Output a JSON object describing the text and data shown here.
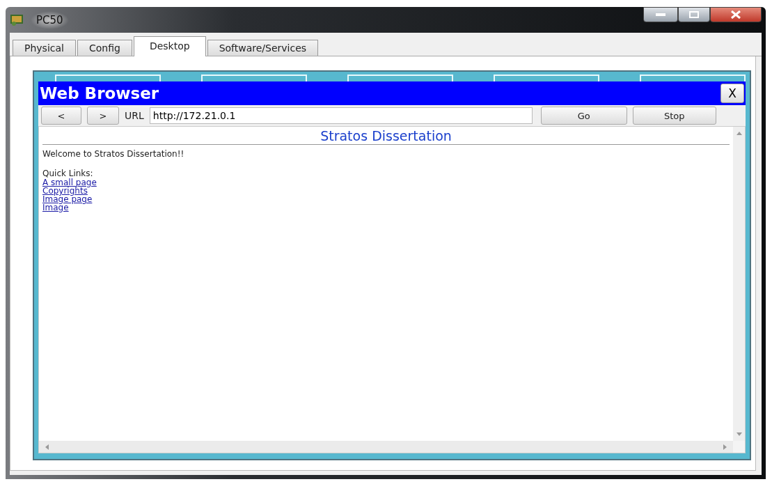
{
  "window": {
    "title": "PC50"
  },
  "tabs": [
    {
      "label": "Physical",
      "selected": false
    },
    {
      "label": "Config",
      "selected": false
    },
    {
      "label": "Desktop",
      "selected": true
    },
    {
      "label": "Software/Services",
      "selected": false
    }
  ],
  "browser": {
    "title": "Web Browser",
    "close": "X",
    "back": "<",
    "forward": ">",
    "url_label": "URL",
    "url": "http://172.21.0.1",
    "go": "Go",
    "stop": "Stop",
    "page": {
      "heading": "Stratos Dissertation",
      "welcome": "Welcome to Stratos Dissertation!!",
      "links_label": "Quick Links:",
      "links": [
        "A small page",
        "Copyrights",
        "Image page",
        "Image"
      ]
    }
  }
}
